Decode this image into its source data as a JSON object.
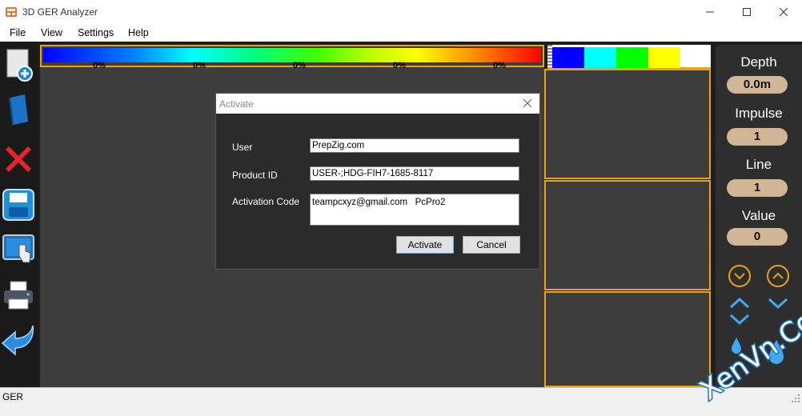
{
  "app": {
    "title": "3D GER Analyzer"
  },
  "menu": {
    "items": [
      "File",
      "View",
      "Settings",
      "Help"
    ]
  },
  "color_scale": {
    "labels": [
      "0%",
      "0%",
      "0%",
      "0%",
      "0%"
    ]
  },
  "palette": {
    "colors": [
      "#0000ff",
      "#00ffff",
      "#00ff00",
      "#ffff00"
    ]
  },
  "controls": {
    "depth_label": "Depth",
    "depth_value": "0.0m",
    "impulse_label": "Impulse",
    "impulse_value": "1",
    "line_label": "Line",
    "line_value": "1",
    "value_label": "Value",
    "value_value": "0"
  },
  "dialog": {
    "title": "Activate",
    "user_label": "User",
    "user_value": "PrepZig.com",
    "product_label": "Product ID",
    "product_value": "USER-;HDG-FIH7-1685-8117",
    "code_label": "Activation Code",
    "code_value": "teampcxyz@gmail.com   PcPro2",
    "activate_label": "Activate",
    "cancel_label": "Cancel"
  },
  "status": {
    "text": "GER"
  },
  "watermark": {
    "text": "XenVn.Com"
  },
  "accent": "#e8a317"
}
